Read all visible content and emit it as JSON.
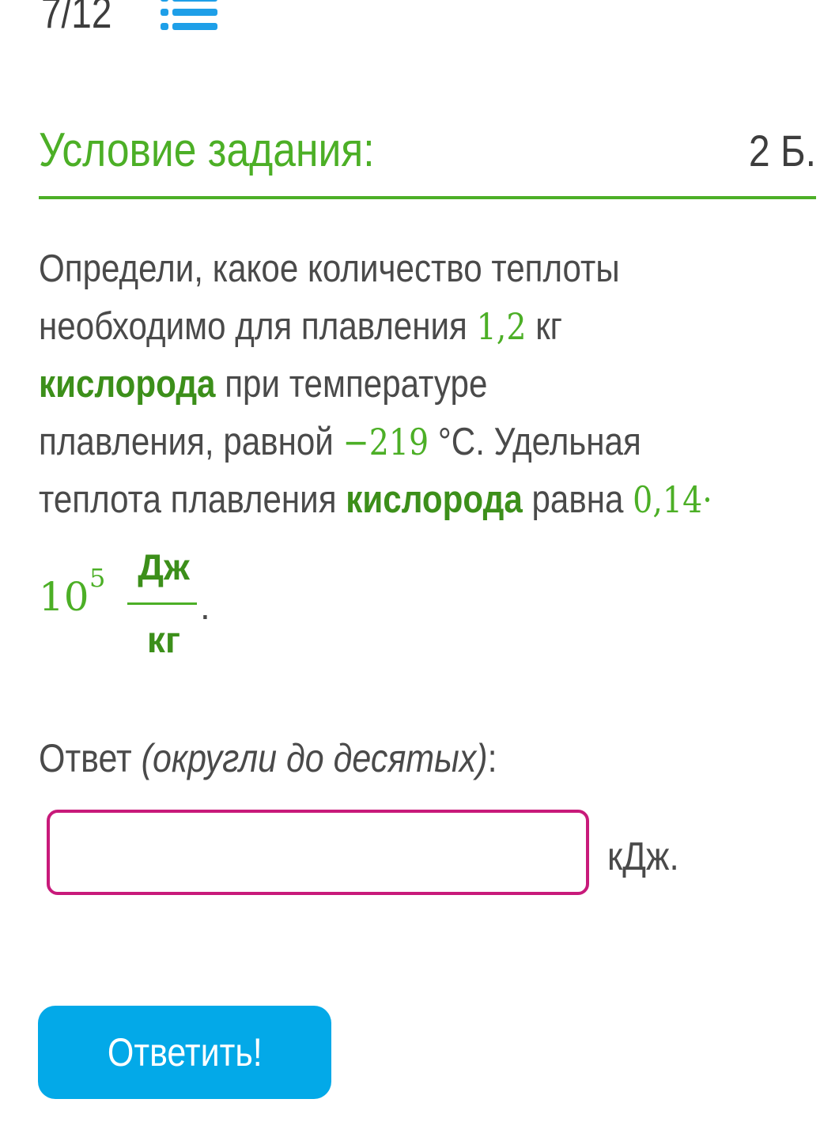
{
  "progress": {
    "counter": "7/12",
    "list_icon": "list-icon",
    "list_icon_color": "#1e9fe8"
  },
  "header": {
    "title": "Условие задания:",
    "points": "2 Б.",
    "accent_color": "#4caf26"
  },
  "task": {
    "line1": "Определи, какое количество теплоты",
    "line2_a": "необходимо для плавления ",
    "mass_value": "1,2",
    "line2_b": " кг",
    "substance": "кислорода",
    "line3_b": " при температуре",
    "line4_a": "плавления, равной ",
    "temperature_value": "−219",
    "line4_b": " °C. Удельная",
    "line5_a": "теплота плавления ",
    "line5_b": " равна ",
    "heat_mantissa": "0,14·",
    "heat_base": "10",
    "heat_exponent": "5",
    "unit_numerator": "Дж",
    "unit_denominator": "кг",
    "period": "."
  },
  "answer": {
    "label": "Ответ ",
    "hint": "(округли до десятых)",
    "colon": ":",
    "input_value": "",
    "unit": "кДж.",
    "border_color": "#c81a7a"
  },
  "submit": {
    "label": "Ответить!",
    "color": "#03a9e8"
  }
}
